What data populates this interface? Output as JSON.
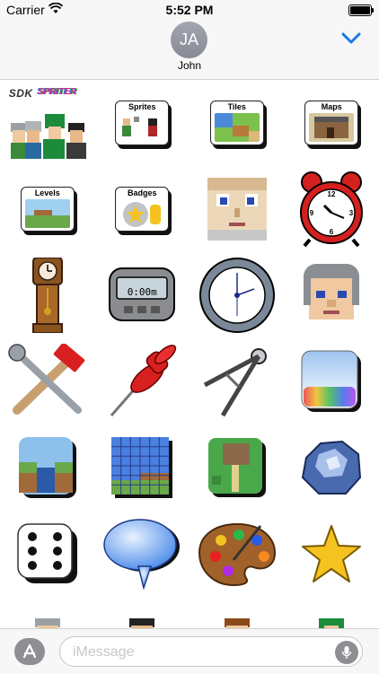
{
  "status_bar": {
    "carrier": "Carrier",
    "time": "5:52 PM"
  },
  "header": {
    "avatar_initials": "JA",
    "contact_name": "John"
  },
  "stickers": {
    "sdk_title": "SDK",
    "sdk_subtitle": "SPRITER",
    "tiles": {
      "sprites": "Sprites",
      "tiles": "Tiles",
      "maps": "Maps",
      "levels": "Levels",
      "badges": "Badges"
    },
    "stopwatch_time": "0:00m"
  },
  "message_bar": {
    "placeholder": "iMessage"
  },
  "colors": {
    "accent": "#1a7ae6",
    "status_bg": "#f7f7f7"
  }
}
